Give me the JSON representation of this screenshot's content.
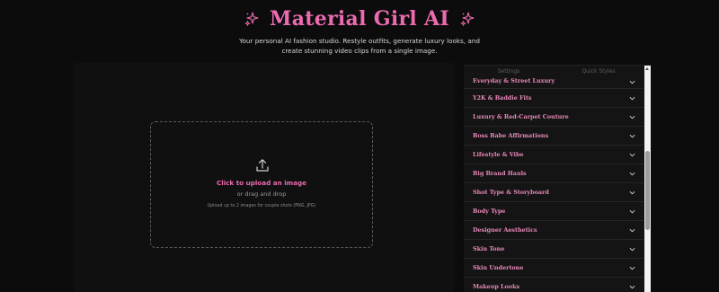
{
  "header": {
    "title": "Material Girl AI",
    "subtitle_line1": "Your personal AI fashion studio. Restyle outfits, generate luxury looks, and",
    "subtitle_line2": "create stunning video clips from a single image.",
    "sparkle_icon": "sparkles-icon",
    "accent_color": "#ec6bb0"
  },
  "upload": {
    "title": "Click to upload an image",
    "subtitle": "or drag and drop",
    "hint": "Upload up to 2 images for couple shots (PNG, JPG)",
    "icon": "upload-icon"
  },
  "panel": {
    "tabs": [
      {
        "label": "Settings"
      },
      {
        "label": "Quick Styles"
      }
    ],
    "items": [
      {
        "label": "Everyday & Street Luxury"
      },
      {
        "label": "Y2K & Baddie Fits"
      },
      {
        "label": "Luxury & Red-Carpet Couture"
      },
      {
        "label": "Boss Babe Affirmations"
      },
      {
        "label": "Lifestyle & Vibe"
      },
      {
        "label": "Big Brand Hauls"
      },
      {
        "label": "Shot Type & Storyboard"
      },
      {
        "label": "Body Type"
      },
      {
        "label": "Designer Aesthetics"
      },
      {
        "label": "Skin Tone"
      },
      {
        "label": "Skin Undertone"
      },
      {
        "label": "Makeup Looks"
      }
    ]
  }
}
